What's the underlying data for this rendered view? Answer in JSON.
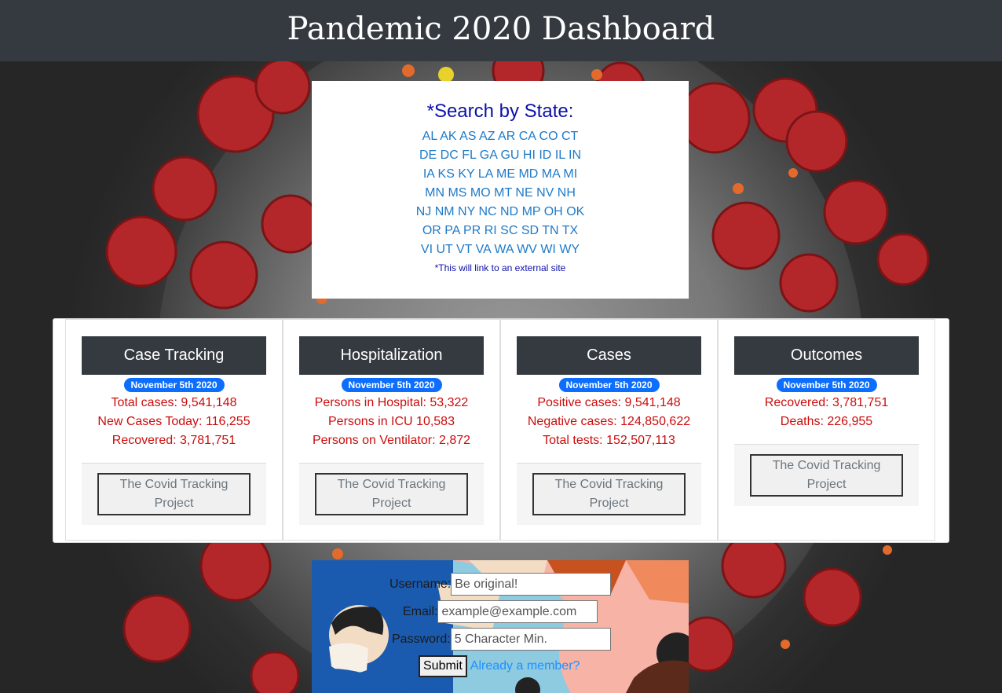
{
  "header": {
    "title": "Pandemic 2020 Dashboard"
  },
  "search": {
    "title": "*Search by State:",
    "rows": [
      [
        "AL",
        "AK",
        "AS",
        "AZ",
        "AR",
        "CA",
        "CO",
        "CT"
      ],
      [
        "DE",
        "DC",
        "FL",
        "GA",
        "GU",
        "HI",
        "ID",
        "IL",
        "IN"
      ],
      [
        "IA",
        "KS",
        "KY",
        "LA",
        "ME",
        "MD",
        "MA",
        "MI"
      ],
      [
        "MN",
        "MS",
        "MO",
        "MT",
        "NE",
        "NV",
        "NH"
      ],
      [
        "NJ",
        "NM",
        "NY",
        "NC",
        "ND",
        "MP",
        "OH",
        "OK"
      ],
      [
        "OR",
        "PA",
        "PR",
        "RI",
        "SC",
        "SD",
        "TN",
        "TX"
      ],
      [
        "VI",
        "UT",
        "VT",
        "VA",
        "WA",
        "WV",
        "WI",
        "WY"
      ]
    ],
    "note": "*This will link to an external site"
  },
  "cards": [
    {
      "title": "Case Tracking",
      "badge": "November 5th 2020",
      "stats": [
        "Total cases: 9,541,148",
        "New Cases Today: 116,255",
        "Recovered: 3,781,751"
      ],
      "button": "The Covid Tracking Project"
    },
    {
      "title": "Hospitalization",
      "badge": "November 5th 2020",
      "stats": [
        "Persons in Hospital: 53,322",
        "Persons in ICU 10,583",
        "Persons on Ventilator: 2,872"
      ],
      "button": "The Covid Tracking Project"
    },
    {
      "title": "Cases",
      "badge": "November 5th 2020",
      "stats": [
        "Positive cases: 9,541,148",
        "Negative cases: 124,850,622",
        "Total tests: 152,507,113"
      ],
      "button": "The Covid Tracking Project"
    },
    {
      "title": "Outcomes",
      "badge": "November 5th 2020",
      "stats": [
        "Recovered: 3,781,751",
        "Deaths: 226,955"
      ],
      "button": "The Covid Tracking Project"
    }
  ],
  "form": {
    "username_label": "Username:",
    "username_placeholder": "Be original!",
    "email_label": "Email:",
    "email_placeholder": "example@example.com",
    "password_label": "Password:",
    "password_placeholder": "5 Character Min.",
    "submit_label": "Submit",
    "member_link": "Already a member?"
  },
  "colors": {
    "header_bg": "#343a40",
    "search_title": "#0c10a8",
    "state_link": "#1e7ac8",
    "stat_text": "#cc0c0c",
    "badge_bg": "#0d6efd",
    "member_link": "#1e90ff"
  }
}
